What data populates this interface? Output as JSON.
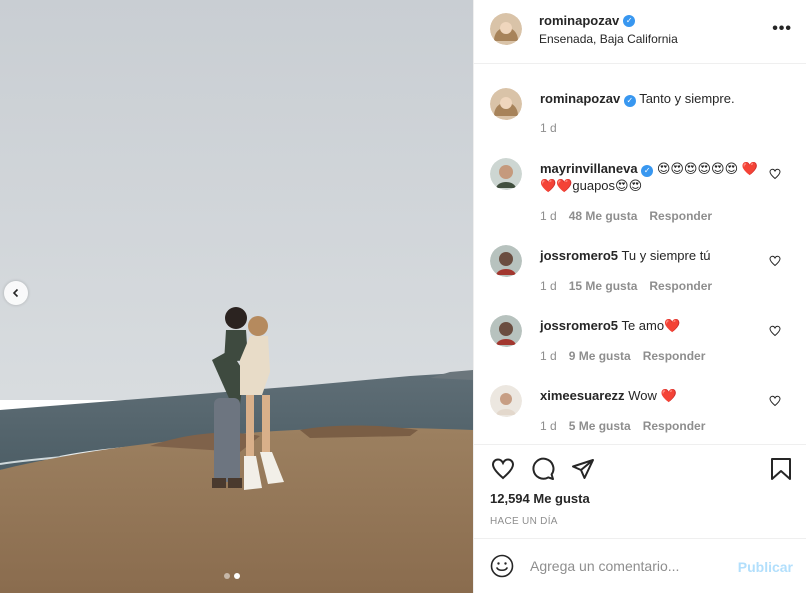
{
  "post": {
    "username": "rominapozav",
    "location": "Ensenada, Baja California",
    "caption": "Tanto y siempre.",
    "caption_time": "1 d",
    "likes": "12,594 Me gusta",
    "posted": "HACE UN DÍA",
    "carousel": {
      "count": 2,
      "active_index": 1
    }
  },
  "comments": [
    {
      "user": "mayrinvillaneva",
      "verified": true,
      "text": "😍😍😍😍😍😍 ❤️❤️❤️guapos😍😍",
      "time": "1 d",
      "likes": "48 Me gusta",
      "reply": "Responder"
    },
    {
      "user": "jossromero5",
      "verified": false,
      "text": "Tu y siempre tú",
      "time": "1 d",
      "likes": "15 Me gusta",
      "reply": "Responder"
    },
    {
      "user": "jossromero5",
      "verified": false,
      "text": "Te amo❤️",
      "time": "1 d",
      "likes": "9 Me gusta",
      "reply": "Responder"
    },
    {
      "user": "ximeesuarezz",
      "verified": false,
      "text": "Wow ❤️",
      "time": "1 d",
      "likes": "5 Me gusta",
      "reply": "Responder"
    }
  ],
  "composer": {
    "placeholder": "Agrega un comentario...",
    "publish": "Publicar"
  },
  "icons": {
    "more": "more-options-icon",
    "like": "heart-icon",
    "comment": "comment-icon",
    "share": "send-icon",
    "save": "bookmark-icon",
    "emoji": "emoji-icon",
    "verified": "verified-badge-icon",
    "prev": "chevron-left-icon"
  },
  "colors": {
    "verified": "#3897f0",
    "link": "#b2dffc",
    "muted": "#8e8e8e"
  }
}
